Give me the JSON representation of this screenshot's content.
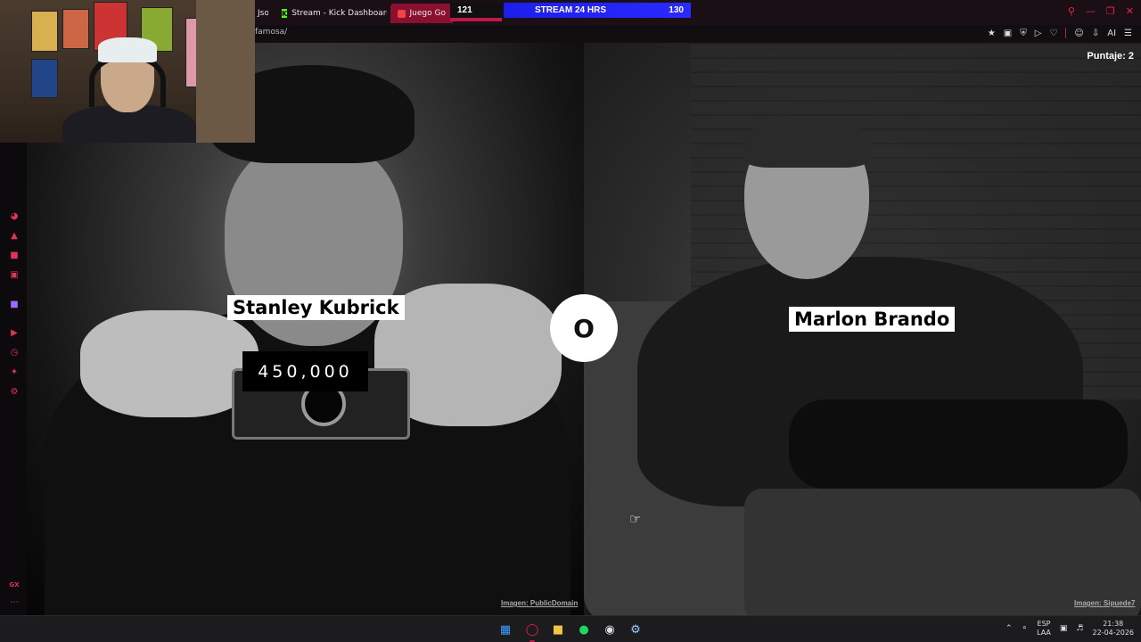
{
  "browser": {
    "tabs": [
      {
        "label": "Jso"
      },
      {
        "label": "Stream - Kick Dashboard"
      },
      {
        "label": "Juego Go"
      }
    ],
    "url": "famosa/"
  },
  "stream_overlay": {
    "left_count": "121",
    "title": "STREAM 24 HRS",
    "right_count": "130"
  },
  "toolbar": {
    "ai_label": "AI"
  },
  "game": {
    "score_label": "Puntaje: 2",
    "left": {
      "name": "Stanley Kubrick",
      "count": "450,000",
      "credit": "Imagen: PublicDomain"
    },
    "right": {
      "name": "Marlon Brando",
      "credit": "Imagen: Sipuede7"
    },
    "or_label": "O"
  },
  "sidebar": {
    "bottom_label": "GX"
  },
  "taskbar": {
    "lang_top": "ESP",
    "lang_bottom": "LAA",
    "time": "21:38",
    "date": "22-04-2026"
  },
  "colors": {
    "accent": "#c0184a",
    "overlay_blue": "#2a2aff",
    "kick_green": "#53fc18"
  }
}
